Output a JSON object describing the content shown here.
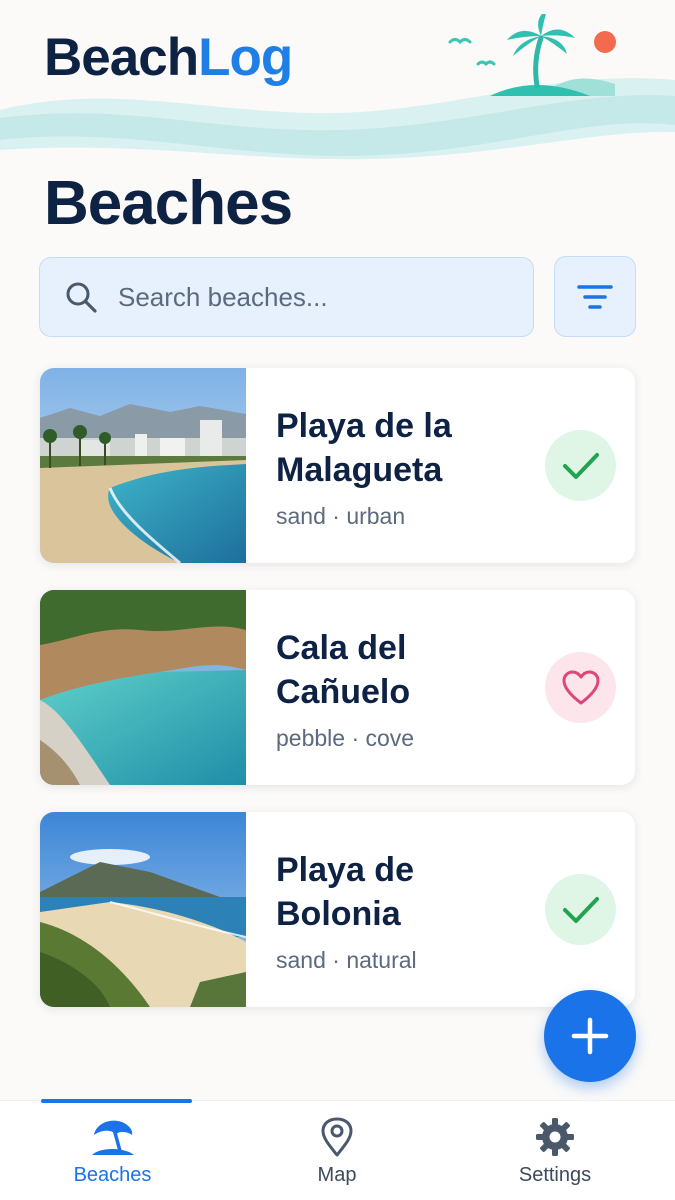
{
  "app": {
    "logo_part1": "Beach",
    "logo_part2": "Log"
  },
  "page": {
    "title": "Beaches"
  },
  "search": {
    "placeholder": "Search beaches...",
    "value": ""
  },
  "beaches": [
    {
      "name": "Playa de la Malagueta",
      "tags": "sand · urban",
      "status": "visited",
      "status_icon": "check-icon"
    },
    {
      "name": "Cala del Cañuelo",
      "tags": "pebble · cove",
      "status": "wishlist",
      "status_icon": "heart-icon"
    },
    {
      "name": "Playa de Bolonia",
      "tags": "sand · natural",
      "status": "visited",
      "status_icon": "check-icon"
    }
  ],
  "nav": {
    "items": [
      {
        "label": "Beaches",
        "icon": "beach-umbrella-icon",
        "active": true
      },
      {
        "label": "Map",
        "icon": "map-pin-icon",
        "active": false
      },
      {
        "label": "Settings",
        "icon": "gear-icon",
        "active": false
      }
    ]
  },
  "colors": {
    "navy": "#0e2244",
    "accent": "#1a73e8",
    "visited": "#22a352",
    "wishlist": "#e0457a",
    "search_bg": "#e7f1fd"
  }
}
